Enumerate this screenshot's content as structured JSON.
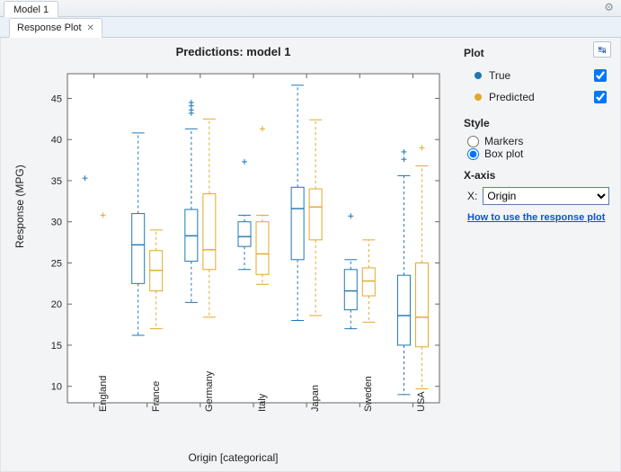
{
  "colors": {
    "true": "#1f77b4",
    "pred": "#e2a82b"
  },
  "title_tab": "Model 1",
  "doc_tab": {
    "label": "Response Plot"
  },
  "plot": {
    "title": "Predictions: model 1",
    "ylabel": "Response (MPG)",
    "xlabel": "Origin [categorical]"
  },
  "legend": {
    "header": "Plot",
    "items": [
      {
        "name": "True",
        "color_key": "true",
        "checked": true
      },
      {
        "name": "Predicted",
        "color_key": "pred",
        "checked": true
      }
    ]
  },
  "style": {
    "header": "Style",
    "options": [
      "Markers",
      "Box plot"
    ],
    "selected": "Box plot"
  },
  "xaxis": {
    "header": "X-axis",
    "label": "X:",
    "selected": "Origin",
    "options": [
      "Origin"
    ]
  },
  "help_link": "How to use the response plot",
  "chart_data": {
    "type": "boxplot",
    "ylim": [
      8,
      48
    ],
    "yticks": [
      10,
      15,
      20,
      25,
      30,
      35,
      40,
      45
    ],
    "categories": [
      "England",
      "France",
      "Germany",
      "Italy",
      "Japan",
      "Sweden",
      "USA"
    ],
    "series": [
      {
        "name": "True",
        "color_key": "true",
        "boxes": [
          {
            "whisker_low": null,
            "q1": null,
            "median": null,
            "q3": null,
            "whisker_high": null,
            "outliers": [
              35.3
            ]
          },
          {
            "whisker_low": 16.2,
            "q1": 22.5,
            "median": 27.2,
            "q3": 31.0,
            "whisker_high": 40.8,
            "outliers": []
          },
          {
            "whisker_low": 20.2,
            "q1": 25.2,
            "median": 28.3,
            "q3": 31.5,
            "whisker_high": 41.3,
            "outliers": [
              43.2,
              43.6,
              44.1,
              44.5
            ]
          },
          {
            "whisker_low": 24.2,
            "q1": 27.0,
            "median": 28.2,
            "q3": 30.0,
            "whisker_high": 30.8,
            "outliers": [
              37.3
            ]
          },
          {
            "whisker_low": 18.0,
            "q1": 25.4,
            "median": 31.6,
            "q3": 34.2,
            "whisker_high": 46.6,
            "outliers": []
          },
          {
            "whisker_low": 17.0,
            "q1": 19.3,
            "median": 21.6,
            "q3": 24.2,
            "whisker_high": 25.4,
            "outliers": [
              30.7
            ]
          },
          {
            "whisker_low": 9.0,
            "q1": 15.0,
            "median": 18.6,
            "q3": 23.5,
            "whisker_high": 35.6,
            "outliers": [
              37.6,
              38.5
            ]
          }
        ]
      },
      {
        "name": "Predicted",
        "color_key": "pred",
        "boxes": [
          {
            "whisker_low": null,
            "q1": null,
            "median": null,
            "q3": null,
            "whisker_high": null,
            "outliers": [
              30.8
            ]
          },
          {
            "whisker_low": 17.0,
            "q1": 21.6,
            "median": 24.1,
            "q3": 26.5,
            "whisker_high": 29.0,
            "outliers": []
          },
          {
            "whisker_low": 18.4,
            "q1": 24.2,
            "median": 26.6,
            "q3": 33.4,
            "whisker_high": 42.5,
            "outliers": []
          },
          {
            "whisker_low": 22.4,
            "q1": 23.6,
            "median": 26.1,
            "q3": 30.0,
            "whisker_high": 30.8,
            "outliers": [
              41.3
            ]
          },
          {
            "whisker_low": 18.6,
            "q1": 27.8,
            "median": 31.8,
            "q3": 34.0,
            "whisker_high": 42.4,
            "outliers": []
          },
          {
            "whisker_low": 17.8,
            "q1": 21.0,
            "median": 22.8,
            "q3": 24.4,
            "whisker_high": 27.8,
            "outliers": []
          },
          {
            "whisker_low": 9.7,
            "q1": 14.8,
            "median": 18.4,
            "q3": 25.0,
            "whisker_high": 36.8,
            "outliers": [
              39.0
            ]
          }
        ]
      }
    ]
  }
}
